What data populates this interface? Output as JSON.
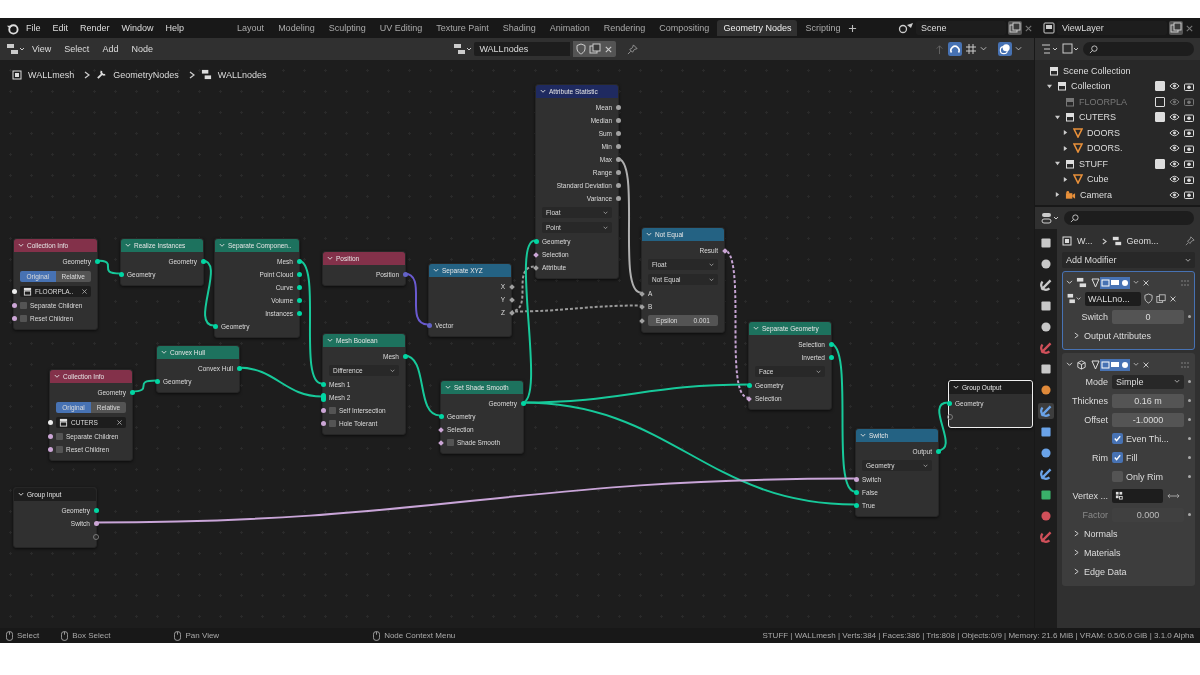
{
  "menus": [
    "File",
    "Edit",
    "Render",
    "Window",
    "Help"
  ],
  "workspaces": [
    {
      "label": "Layout",
      "selected": false
    },
    {
      "label": "Modeling",
      "selected": false
    },
    {
      "label": "Sculpting",
      "selected": false
    },
    {
      "label": "UV Editing",
      "selected": false
    },
    {
      "label": "Texture Paint",
      "selected": false
    },
    {
      "label": "Shading",
      "selected": false
    },
    {
      "label": "Animation",
      "selected": false
    },
    {
      "label": "Rendering",
      "selected": false
    },
    {
      "label": "Compositing",
      "selected": false
    },
    {
      "label": "Geometry Nodes",
      "selected": true
    },
    {
      "label": "Scripting",
      "selected": false
    }
  ],
  "scene": "Scene",
  "view_layer": "ViewLayer",
  "editor_menus": [
    "View",
    "Select",
    "Add",
    "Node"
  ],
  "node_tree": "WALLnodes",
  "breadcrumbs": [
    "WALLmesh",
    "GeometryNodes",
    "WALLnodes"
  ],
  "nodes": [
    {
      "title": "Collection Info",
      "color": "#83314a",
      "selected": false,
      "rows": [
        {
          "kind": "output",
          "label": "Geometry",
          "socket": {
            "kind": "round",
            "color": "#00d6a3"
          }
        },
        {
          "kind": "toggle",
          "options": [
            {
              "label": "Original",
              "selected": true
            },
            {
              "label": "Relative",
              "selected": false
            }
          ]
        },
        {
          "kind": "datablock",
          "value": "FLOORPLA..",
          "socket": {
            "kind": "round",
            "color": "#ededed"
          }
        },
        {
          "kind": "checkbox",
          "label": "Separate Children",
          "checked": false,
          "socket": {
            "kind": "round",
            "color": "#cca6d6"
          }
        },
        {
          "kind": "checkbox",
          "label": "Reset Children",
          "checked": false,
          "socket": {
            "kind": "round",
            "color": "#cca6d6"
          }
        }
      ]
    },
    {
      "title": "Realize Instances",
      "color": "#1d725e",
      "selected": false,
      "rows": [
        {
          "kind": "output",
          "label": "Geometry",
          "socket": {
            "kind": "round",
            "color": "#00d6a3"
          }
        },
        {
          "kind": "input",
          "label": "Geometry",
          "socket": {
            "kind": "round",
            "color": "#00d6a3"
          }
        }
      ]
    },
    {
      "title": "Separate Componen..",
      "color": "#1d725e",
      "selected": false,
      "rows": [
        {
          "kind": "output",
          "label": "Mesh",
          "socket": {
            "kind": "round",
            "color": "#00d6a3"
          }
        },
        {
          "kind": "output",
          "label": "Point Cloud",
          "socket": {
            "kind": "round",
            "color": "#00d6a3"
          }
        },
        {
          "kind": "output",
          "label": "Curve",
          "socket": {
            "kind": "round",
            "color": "#00d6a3"
          }
        },
        {
          "kind": "output",
          "label": "Volume",
          "socket": {
            "kind": "round",
            "color": "#00d6a3"
          }
        },
        {
          "kind": "output",
          "label": "Instances",
          "socket": {
            "kind": "round",
            "color": "#00d6a3"
          }
        },
        {
          "kind": "input",
          "label": "Geometry",
          "socket": {
            "kind": "round",
            "color": "#00d6a3"
          }
        }
      ]
    },
    {
      "title": "Position",
      "color": "#83314a",
      "selected": false,
      "rows": [
        {
          "kind": "output",
          "label": "Position",
          "socket": {
            "kind": "round",
            "color": "#6363c7"
          }
        }
      ]
    },
    {
      "title": "Separate XYZ",
      "color": "#246283",
      "selected": false,
      "rows": [
        {
          "kind": "output",
          "label": "X",
          "socket": {
            "kind": "diamond",
            "color": "#a1a1a1"
          }
        },
        {
          "kind": "output",
          "label": "Y",
          "socket": {
            "kind": "diamond",
            "color": "#a1a1a1"
          }
        },
        {
          "kind": "output",
          "label": "Z",
          "socket": {
            "kind": "diamond",
            "color": "#a1a1a1"
          }
        },
        {
          "kind": "input",
          "label": "Vector",
          "socket": {
            "kind": "round",
            "color": "#6363c7"
          }
        }
      ]
    },
    {
      "title": "Attribute Statistic",
      "color": "#1f2a60",
      "selected": false,
      "rows": [
        {
          "kind": "output",
          "label": "Mean",
          "socket": {
            "kind": "round",
            "color": "#a1a1a1"
          }
        },
        {
          "kind": "output",
          "label": "Median",
          "socket": {
            "kind": "round",
            "color": "#a1a1a1"
          }
        },
        {
          "kind": "output",
          "label": "Sum",
          "socket": {
            "kind": "round",
            "color": "#a1a1a1"
          }
        },
        {
          "kind": "output",
          "label": "Min",
          "socket": {
            "kind": "round",
            "color": "#a1a1a1"
          }
        },
        {
          "kind": "output",
          "label": "Max",
          "socket": {
            "kind": "round",
            "color": "#a1a1a1"
          }
        },
        {
          "kind": "output",
          "label": "Range",
          "socket": {
            "kind": "round",
            "color": "#a1a1a1"
          }
        },
        {
          "kind": "output",
          "label": "Standard Deviation",
          "socket": {
            "kind": "round",
            "color": "#a1a1a1"
          }
        },
        {
          "kind": "output",
          "label": "Variance",
          "socket": {
            "kind": "round",
            "color": "#a1a1a1"
          }
        },
        {
          "kind": "dropdown",
          "value": "Float"
        },
        {
          "kind": "dropdown",
          "value": "Point"
        },
        {
          "kind": "input",
          "label": "Geometry",
          "socket": {
            "kind": "round",
            "color": "#00d6a3"
          }
        },
        {
          "kind": "input",
          "label": "Selection",
          "socket": {
            "kind": "diamond",
            "color": "#cca6d6"
          }
        },
        {
          "kind": "input",
          "label": "Attribute",
          "socket": {
            "kind": "diamond",
            "color": "#a1a1a1"
          }
        }
      ]
    },
    {
      "title": "Not Equal",
      "color": "#246283",
      "selected": false,
      "rows": [
        {
          "kind": "output",
          "label": "Result",
          "socket": {
            "kind": "diamond",
            "color": "#cca6d6"
          }
        },
        {
          "kind": "dropdown",
          "value": "Float"
        },
        {
          "kind": "dropdown",
          "value": "Not Equal"
        },
        {
          "kind": "input",
          "label": "A",
          "socket": {
            "kind": "diamond",
            "color": "#a1a1a1"
          }
        },
        {
          "kind": "input",
          "label": "B",
          "socket": {
            "kind": "diamond",
            "color": "#a1a1a1"
          }
        },
        {
          "kind": "field",
          "label": "Epsilon",
          "value": "0.001",
          "socket": {
            "kind": "diamond",
            "color": "#a1a1a1"
          }
        }
      ]
    },
    {
      "title": "Mesh Boolean",
      "color": "#1d725e",
      "selected": false,
      "rows": [
        {
          "kind": "output",
          "label": "Mesh",
          "socket": {
            "kind": "round",
            "color": "#00d6a3"
          }
        },
        {
          "kind": "dropdown",
          "value": "Difference"
        },
        {
          "kind": "input",
          "label": "Mesh 1",
          "socket": {
            "kind": "round",
            "color": "#00d6a3"
          }
        },
        {
          "kind": "input",
          "label": "Mesh 2",
          "socket": {
            "kind": "multi",
            "color": "#00d6a3"
          }
        },
        {
          "kind": "checkbox",
          "label": "Self Intersection",
          "checked": false,
          "socket": {
            "kind": "round",
            "color": "#cca6d6"
          }
        },
        {
          "kind": "checkbox",
          "label": "Hole Tolerant",
          "checked": false,
          "socket": {
            "kind": "round",
            "color": "#cca6d6"
          }
        }
      ]
    },
    {
      "title": "Convex Hull",
      "color": "#1d725e",
      "selected": false,
      "rows": [
        {
          "kind": "output",
          "label": "Convex Hull",
          "socket": {
            "kind": "round",
            "color": "#00d6a3"
          }
        },
        {
          "kind": "input",
          "label": "Geometry",
          "socket": {
            "kind": "round",
            "color": "#00d6a3"
          }
        }
      ]
    },
    {
      "title": "Collection Info",
      "color": "#83314a",
      "selected": false,
      "rows": [
        {
          "kind": "output",
          "label": "Geometry",
          "socket": {
            "kind": "round",
            "color": "#00d6a3"
          }
        },
        {
          "kind": "toggle",
          "options": [
            {
              "label": "Original",
              "selected": true
            },
            {
              "label": "Relative",
              "selected": false
            }
          ]
        },
        {
          "kind": "datablock",
          "value": "CUTERS",
          "socket": {
            "kind": "round",
            "color": "#ededed"
          }
        },
        {
          "kind": "checkbox",
          "label": "Separate Children",
          "checked": false,
          "socket": {
            "kind": "round",
            "color": "#cca6d6"
          }
        },
        {
          "kind": "checkbox",
          "label": "Reset Children",
          "checked": false,
          "socket": {
            "kind": "round",
            "color": "#cca6d6"
          }
        }
      ]
    },
    {
      "title": "Set Shade Smooth",
      "color": "#1d725e",
      "selected": false,
      "rows": [
        {
          "kind": "output",
          "label": "Geometry",
          "socket": {
            "kind": "round",
            "color": "#00d6a3"
          }
        },
        {
          "kind": "input",
          "label": "Geometry",
          "socket": {
            "kind": "round",
            "color": "#00d6a3"
          }
        },
        {
          "kind": "input",
          "label": "Selection",
          "socket": {
            "kind": "diamond",
            "color": "#cca6d6"
          }
        },
        {
          "kind": "checkbox",
          "label": "Shade Smooth",
          "checked": false,
          "socket": {
            "kind": "diamond",
            "color": "#cca6d6"
          }
        }
      ]
    },
    {
      "title": "Separate Geometry",
      "color": "#1d725e",
      "selected": false,
      "rows": [
        {
          "kind": "output",
          "label": "Selection",
          "socket": {
            "kind": "round",
            "color": "#00d6a3"
          }
        },
        {
          "kind": "output",
          "label": "Inverted",
          "socket": {
            "kind": "round",
            "color": "#00d6a3"
          }
        },
        {
          "kind": "dropdown",
          "value": "Face"
        },
        {
          "kind": "input",
          "label": "Geometry",
          "socket": {
            "kind": "round",
            "color": "#00d6a3"
          }
        },
        {
          "kind": "input",
          "label": "Selection",
          "socket": {
            "kind": "diamond",
            "color": "#cca6d6"
          }
        }
      ]
    },
    {
      "title": "Switch",
      "color": "#246283",
      "selected": false,
      "rows": [
        {
          "kind": "output",
          "label": "Output",
          "socket": {
            "kind": "round",
            "color": "#00d6a3"
          }
        },
        {
          "kind": "dropdown",
          "value": "Geometry"
        },
        {
          "kind": "input",
          "label": "Switch",
          "socket": {
            "kind": "round",
            "color": "#cca6d6"
          }
        },
        {
          "kind": "input",
          "label": "False",
          "socket": {
            "kind": "round",
            "color": "#00d6a3"
          }
        },
        {
          "kind": "input",
          "label": "True",
          "socket": {
            "kind": "round",
            "color": "#00d6a3"
          }
        }
      ]
    },
    {
      "title": "Group Output",
      "color": "#1d1d1d",
      "selected": true,
      "rows": [
        {
          "kind": "input",
          "label": "Geometry",
          "socket": {
            "kind": "round",
            "color": "#00d6a3"
          }
        },
        {
          "kind": "input",
          "socket": {
            "kind": "hollow",
            "color": "#7a7a7a"
          }
        }
      ]
    },
    {
      "title": "Group Input",
      "color": "#1d1d1d",
      "selected": false,
      "rows": [
        {
          "kind": "output",
          "label": "Geometry",
          "socket": {
            "kind": "round",
            "color": "#00d6a3"
          }
        },
        {
          "kind": "output",
          "label": "Switch",
          "socket": {
            "kind": "round",
            "color": "#cca6d6"
          }
        },
        {
          "kind": "output",
          "socket": {
            "kind": "hollow",
            "color": "#7a7a7a"
          }
        }
      ]
    }
  ],
  "outliner": [
    {
      "label": "Scene Collection",
      "kind": "scene",
      "children": [
        {
          "label": "Collection",
          "kind": "collection",
          "expanded": true,
          "checked": true,
          "children": [
            {
              "label": "FLOORPLA",
              "kind": "collection",
              "checked": false
            },
            {
              "label": "CUTERS",
              "kind": "collection",
              "expanded": true,
              "checked": true,
              "children": [
                {
                  "label": "DOORS",
                  "kind": "mesh",
                  "expanded": false
                },
                {
                  "label": "DOORS.",
                  "kind": "mesh",
                  "expanded": false
                }
              ]
            },
            {
              "label": "STUFF",
              "kind": "collection",
              "expanded": true,
              "checked": true,
              "children": [
                {
                  "label": "Cube",
                  "kind": "mesh",
                  "expanded": false
                }
              ]
            },
            {
              "label": "Camera",
              "kind": "camera",
              "expanded": false
            }
          ]
        }
      ]
    }
  ],
  "properties_tabs": [
    {
      "selected": false
    },
    {
      "selected": false
    },
    {
      "selected": false
    },
    {
      "selected": false
    },
    {
      "selected": false
    },
    {
      "selected": false
    },
    {
      "selected": false
    },
    {
      "selected": false
    },
    {
      "selected": true
    },
    {
      "selected": false
    },
    {
      "selected": false
    },
    {
      "selected": false
    },
    {
      "selected": false
    },
    {
      "selected": false
    },
    {
      "selected": false
    }
  ],
  "properties": {
    "breadcrumb": [
      "W...",
      "Geom..."
    ],
    "add_modifier": "Add Modifier",
    "modifiers": [
      {
        "kind": "nodes",
        "active": true,
        "expanded": true,
        "node_tree": "WALLno...",
        "rows": [
          {
            "kind": "number",
            "label": "Switch",
            "value": "0"
          }
        ],
        "subpanels": [
          {
            "label": "Output Attributes",
            "expanded": false
          }
        ]
      },
      {
        "kind": "solidify",
        "active": false,
        "expanded": true,
        "rows": [
          {
            "kind": "dropdown",
            "label": "Mode",
            "value": "Simple"
          },
          {
            "kind": "number",
            "label": "Thicknes",
            "value": "0.16 m"
          },
          {
            "kind": "number",
            "label": "Offset",
            "value": "-1.0000"
          },
          {
            "kind": "checkbox",
            "text": "Even Thi...",
            "checked": true
          },
          {
            "kind": "checkbox",
            "label": "Rim",
            "text": "Fill",
            "checked": true
          },
          {
            "kind": "checkbox",
            "text": "Only Rim",
            "checked": false
          },
          {
            "kind": "vertex_group",
            "label": "Vertex ..."
          },
          {
            "kind": "number",
            "label": "Factor",
            "value": "0.000",
            "disabled": true
          }
        ],
        "subpanels": [
          {
            "label": "Normals",
            "expanded": false
          },
          {
            "label": "Materials",
            "expanded": false
          },
          {
            "label": "Edge Data",
            "expanded": false
          }
        ]
      }
    ]
  },
  "status_hints": [
    "Select",
    "Box Select",
    "Pan View",
    "Node Context Menu"
  ],
  "status_stats": "STUFF | WALLmesh | Verts:384 | Faces:386 | Tris:808 | Objects:0/9 | Memory: 21.6 MiB | VRAM: 0.5/6.0 GiB | 3.1.0 Alpha"
}
